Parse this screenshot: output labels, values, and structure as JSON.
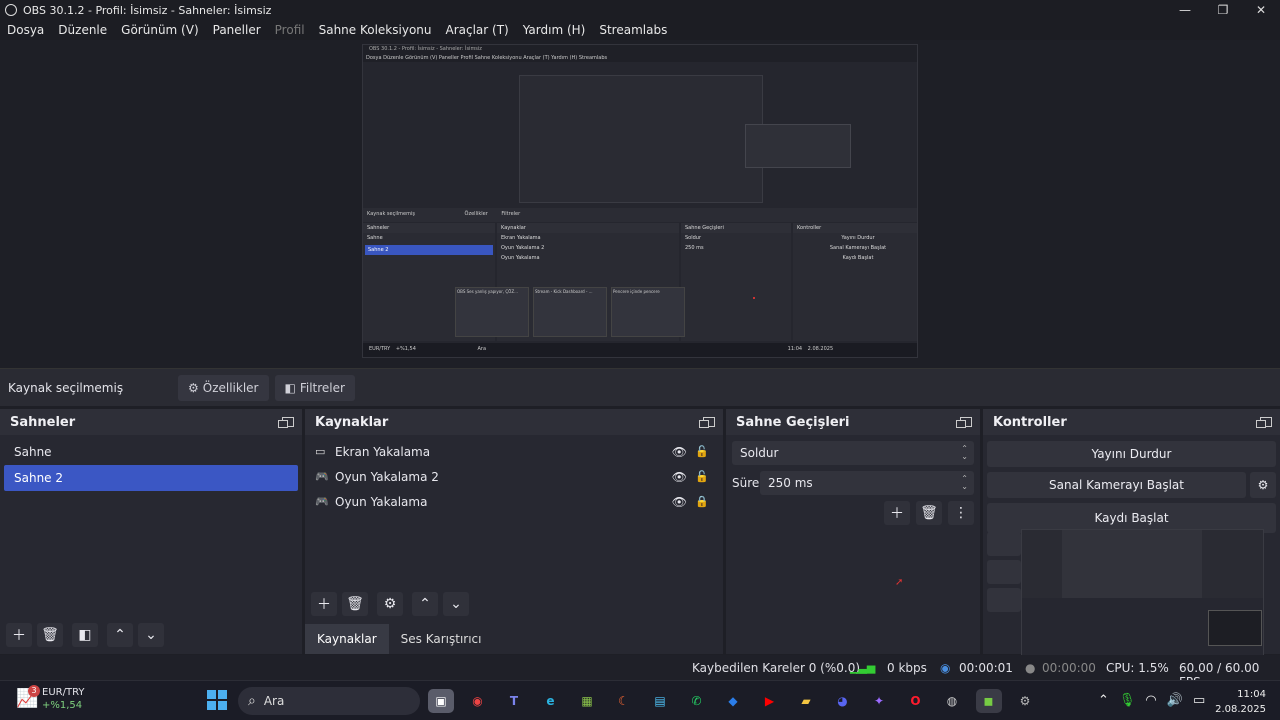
{
  "window": {
    "title": "OBS 30.1.2 - Profil: İsimsiz - Sahneler: İsimsiz",
    "controls": [
      "—",
      "❐",
      "✕"
    ]
  },
  "menu": [
    "Dosya",
    "Düzenle",
    "Görünüm (V)",
    "Paneller",
    "Profil",
    "Sahne Koleksiyonu",
    "Araçlar (T)",
    "Yardım (H)",
    "Streamlabs"
  ],
  "preview": {
    "title": "OBS 30.1.2 - Profil: İsimsiz - Sahneler: İsimsiz",
    "menu": "Dosya  Düzenle  Görünüm (V)  Paneller  Profil  Sahne Koleksiyonu  Araçlar (T)  Yardım (H)  Streamlabs",
    "no_source": "Kaynak seçilmemiş",
    "props": "Özellikler",
    "filters": "Filtreler",
    "scenes_title": "Sahneler",
    "sources_title": "Kaynaklar",
    "transitions_title": "Sahne Geçişleri",
    "controls_title": "Kontroller",
    "scene1": "Sahne",
    "scene2": "Sahne 2",
    "src1": "Ekran Yakalama",
    "src2": "Oyun Yakalama 2",
    "src3": "Oyun Yakalama",
    "trans": "Soldur",
    "dur": "250 ms",
    "btn1": "Yayını Durdur",
    "btn2": "Sanal Kamerayı Başlat",
    "btn3": "Kaydı Başlat",
    "thumb1": "OBS Ses yanlış yapıyor, ÇÖZ...",
    "thumb2": "Stream - Kick Dashboard - ...",
    "thumb3": "Pencere içinde pencere",
    "status": "Kaybedilen Kareler 0 (%0.0)    0 kbps    00:00:01",
    "tb_weather": "EUR/TRY",
    "tb_weather_change": "+%1,54",
    "tb_search": "Ara",
    "tb_time": "11:04",
    "tb_date": "2.08.2025"
  },
  "context_bar": {
    "no_source": "Kaynak seçilmemiş",
    "properties": "Özellikler",
    "filters": "Filtreler"
  },
  "scenes": {
    "title": "Sahneler",
    "items": [
      {
        "label": "Sahne",
        "selected": false
      },
      {
        "label": "Sahne 2",
        "selected": true
      }
    ]
  },
  "sources": {
    "title": "Kaynaklar",
    "items": [
      {
        "label": "Ekran Yakalama",
        "icon": "monitor-icon",
        "locked": false
      },
      {
        "label": "Oyun Yakalama 2",
        "icon": "gamepad-icon",
        "locked": false
      },
      {
        "label": "Oyun Yakalama",
        "icon": "gamepad-icon",
        "locked": true
      }
    ],
    "tabs": [
      "Kaynaklar",
      "Ses Karıştırıcı"
    ]
  },
  "transitions": {
    "title": "Sahne Geçişleri",
    "selected": "Soldur",
    "duration_label": "Süre",
    "duration_value": "250 ms"
  },
  "controls": {
    "title": "Kontroller",
    "stop_stream": "Yayını Durdur",
    "start_virtualcam": "Sanal Kamerayı Başlat",
    "start_record": "Kaydı Başlat"
  },
  "status": {
    "dropped": "Kaybedilen Kareler 0 (%0.0)",
    "kbps": "0 kbps",
    "stream_time": "00:00:01",
    "rec_time": "00:00:00",
    "cpu": "CPU: 1.5%",
    "fps": "60.00 / 60.00 FPS"
  },
  "taskbar": {
    "weather_badge": "3",
    "ticker": "EUR/TRY",
    "ticker_change": "+%1,54",
    "search_placeholder": "Ara",
    "time": "11:04",
    "date": "2.08.2025"
  },
  "colors": {
    "accent": "#3b57c4",
    "panel": "#272831",
    "background": "#1e1f26"
  }
}
